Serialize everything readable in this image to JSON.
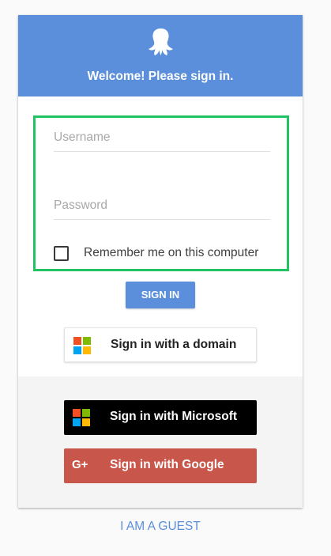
{
  "header": {
    "title": "Welcome! Please sign in.",
    "logo_icon": "octopus-icon",
    "background_color": "#5b8fdb"
  },
  "form": {
    "username_placeholder": "Username",
    "username_value": "",
    "password_placeholder": "Password",
    "password_value": "",
    "remember_label": "Remember me on this computer",
    "remember_checked": false,
    "highlight_color": "#21c362"
  },
  "buttons": {
    "sign_in": "SIGN IN",
    "domain": "Sign in with a domain",
    "microsoft": "Sign in with Microsoft",
    "google": "Sign in with Google",
    "google_icon_text": "G+"
  },
  "guest_link": "I AM A GUEST",
  "colors": {
    "accent": "#5b8fdb",
    "microsoft_bg": "#000000",
    "google_bg": "#c9564a"
  }
}
